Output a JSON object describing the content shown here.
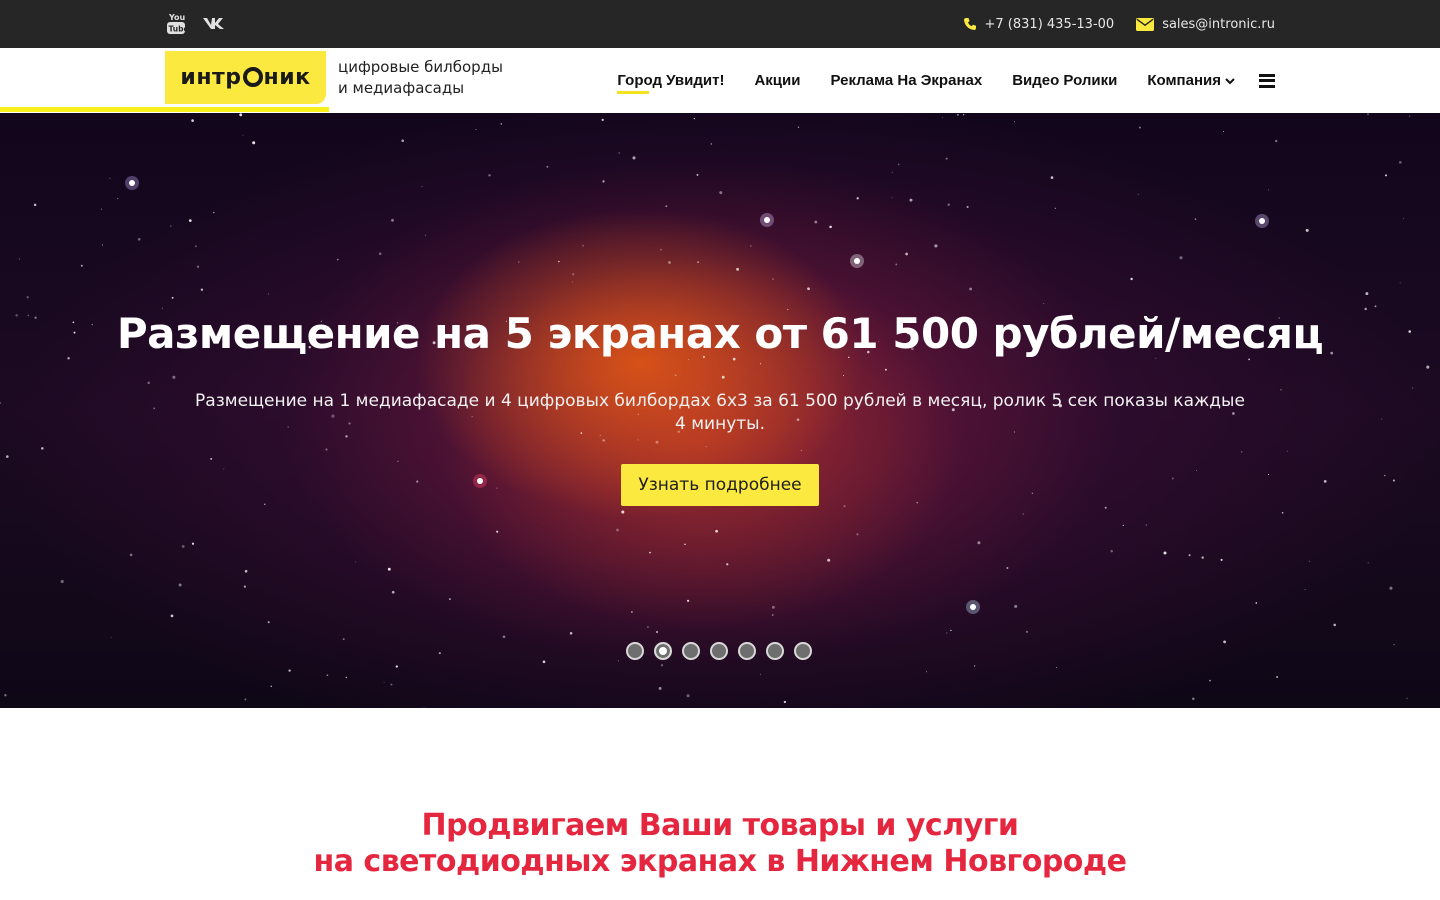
{
  "topbar": {
    "social": [
      {
        "name": "youtube-icon",
        "label": "YouTube"
      },
      {
        "name": "vk-icon",
        "label": "VK"
      }
    ],
    "phone": "+7 (831) 435-13-00",
    "email": "sales@intronic.ru"
  },
  "header": {
    "logo_text_before": "интр",
    "logo_text_after": "ник",
    "tagline_line1": "цифровые билборды",
    "tagline_line2": "и медиафасады",
    "nav": [
      {
        "label": "Город Увидит!",
        "active": true
      },
      {
        "label": "Акции",
        "active": false
      },
      {
        "label": "Реклама На Экранах",
        "active": false
      },
      {
        "label": "Видео Ролики",
        "active": false
      },
      {
        "label": "Компания",
        "active": false,
        "dropdown": true
      }
    ]
  },
  "hero": {
    "title": "Размещение на 5 экранах от 61 500 рублей/месяц",
    "subtitle": "Размещение на 1 медиафасаде и 4 цифровых билбордах 6х3 за 61 500 рублей в месяц, ролик 5 сек показы каждые 4 минуты.",
    "cta_label": "Узнать подробнее",
    "slides_count": 7,
    "active_slide": 2
  },
  "section": {
    "title_line1": "Продвигаем Ваши товары и услуги",
    "title_line2": "на светодиодных экранах в Нижнем Новгороде"
  },
  "colors": {
    "accent_yellow": "#fbe93f",
    "heading_red": "#e5263f",
    "topbar_bg": "#262626"
  }
}
